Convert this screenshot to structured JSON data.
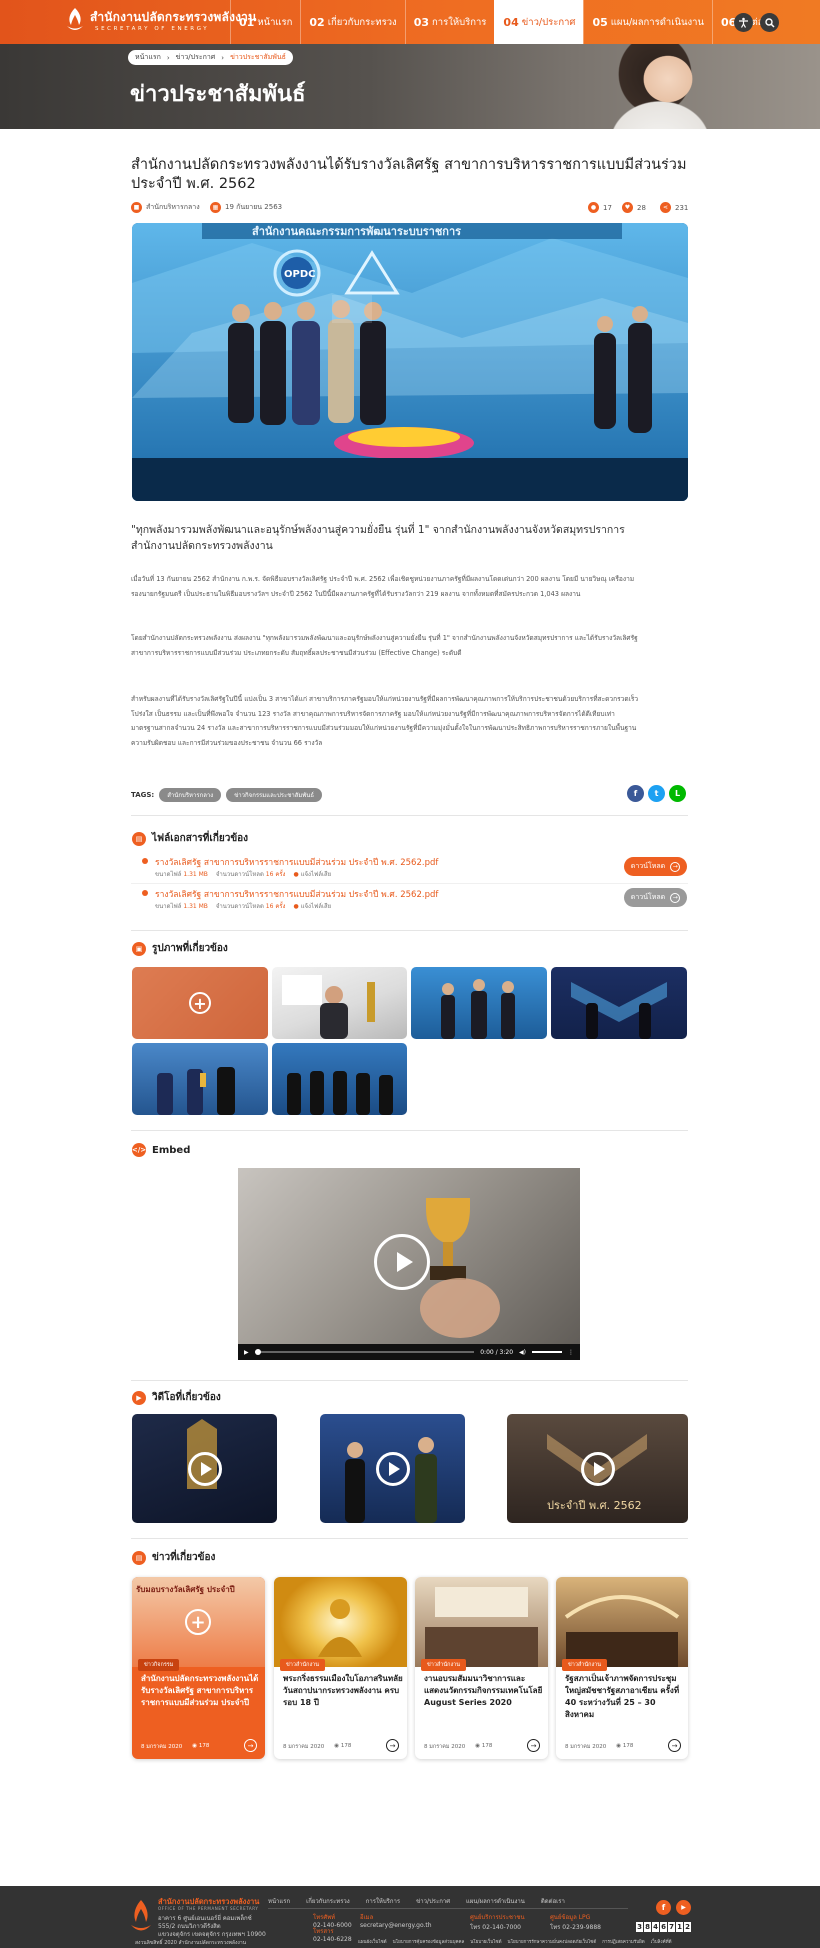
{
  "header": {
    "logo_th": "สำนักงานปลัดกระทรวงพลังงาน",
    "logo_en": "SECRETARY OF ENERGY",
    "nav": [
      {
        "num": "01",
        "label": "หน้าแรก"
      },
      {
        "num": "02",
        "label": "เกี่ยวกับกระทรวง"
      },
      {
        "num": "03",
        "label": "การให้บริการ"
      },
      {
        "num": "04",
        "label": "ข่าว/ประกาศ"
      },
      {
        "num": "05",
        "label": "แผน/ผลการดำเนินงาน"
      },
      {
        "num": "06",
        "label": "ติดต่อเรา"
      }
    ],
    "accessibility_icon": "accessibility-icon",
    "search_icon": "search-icon"
  },
  "banner": {
    "breadcrumb": [
      "หน้าแรก",
      "ข่าว/ประกาศ",
      "ข่าวประชาสัมพันธ์"
    ],
    "title": "ข่าวประชาสัมพันธ์"
  },
  "article": {
    "title": "สำนักงานปลัดกระทรวงพลังงานได้รับรางวัลเลิศรัฐ สาขาการบริหารราชการแบบมีส่วนร่วม ประจำปี พ.ศ. 2562",
    "author": "สำนักบริหารกลาง",
    "date": "19 กันยายน 2563",
    "views": "17",
    "likes": "28",
    "shares": "231",
    "hero_banner_text": "สำนักงานคณะกรรมการพัฒนาระบบราชการ",
    "hero_logo": "OPDC",
    "lead": "\"ทุกพลังมารวมพลังพัฒนาและอนุรักษ์พลังงานสู่ความยั่งยืน รุ่นที่ 1\" จากสำนักงานพลังงานจังหวัดสมุทรปราการ สำนักงานปลัดกระทรวงพลังงาน",
    "paragraphs": [
      "เมื่อวันที่ 13 กันยายน 2562 สำนักงาน ก.พ.ร. จัดพิธีมอบรางวัลเลิศรัฐ ประจำปี พ.ศ. 2562 เพื่อเชิดชูหน่วยงานภาครัฐที่มีผลงานโดดเด่นกว่า 200 ผลงาน โดยมี นายวิษณุ เครืองาม รองนายกรัฐมนตรี เป็นประธานในพิธีมอบรางวัลฯ ประจำปี 2562 ในปีนี้มีผลงานภาครัฐที่ได้รับรางวัลกว่า 219 ผลงาน จากทั้งหมดที่สมัครประกวด 1,043 ผลงาน",
      "โดยสำนักงานปลัดกระทรวงพลังงาน ส่งผลงาน \"ทุกพลังมารวมพลังพัฒนาและอนุรักษ์พลังงานสู่ความยั่งยืน รุ่นที่ 1\" จากสำนักงานพลังงานจังหวัดสมุทรปราการ และได้รับรางวัลเลิศรัฐ สาขาการบริหารราชการแบบมีส่วนร่วม ประเภทยกระดับ สัมฤทธิ์ผลประชาชนมีส่วนร่วม (Effective Change) ระดับดี",
      "สำหรับผลงานที่ได้รับรางวัลเลิศรัฐในปีนี้ แบ่งเป็น 3 สาขาได้แก่ สาขาบริการภาครัฐมอบให้แก่หน่วยงานรัฐที่มีผลการพัฒนาคุณภาพการให้บริการประชาชนด้วยบริการที่สะดวกรวดเร็ว โปร่งใส เป็นธรรม และเป็นที่พึงพอใจ จำนวน 123 รางวัล สาขาคุณภาพการบริหารจัดการภาครัฐ มอบให้แก่หน่วยงานรัฐที่มีการพัฒนาคุณภาพการบริหารจัดการได้ดีเทียบเท่ามาตรฐานสากลจำนวน 24 รางวัล และสาขาการบริหารราชการแบบมีส่วนร่วมมอบให้แก่หน่วยงานรัฐที่มีความมุ่งมั่นตั้งใจในการพัฒนาประสิทธิภาพการบริหารราชการภายในพื้นฐานความรับผิดชอบ และการมีส่วนร่วมของประชาชน จำนวน 66 รางวัล"
    ],
    "tags_label": "TAGS:",
    "tags": [
      "สำนักบริหารกลาง",
      "ข่าวกิจกรรมและประชาสัมพันธ์"
    ],
    "share": [
      {
        "icon": "facebook-icon",
        "glyph": "f",
        "color": "#3b5998"
      },
      {
        "icon": "twitter-icon",
        "glyph": "t",
        "color": "#1da1f2"
      },
      {
        "icon": "line-icon",
        "glyph": "L",
        "color": "#00b900"
      }
    ]
  },
  "files": {
    "heading": "ไฟล์เอกสารที่เกี่ยวข้อง",
    "items": [
      {
        "name": "รางวัลเลิศรัฐ สาขาการบริหารราชการแบบมีส่วนร่วม ประจำปี พ.ศ. 2562.pdf",
        "size_label": "ขนาดไฟล์",
        "size": "1.31 MB",
        "dl_label": "จำนวนดาวน์โหลด",
        "downloads": "16 ครั้ง",
        "report": "แจ้งไฟล์เสีย",
        "button": "ดาวน์โหลด",
        "button_color": "#ee5f21"
      },
      {
        "name": "รางวัลเลิศรัฐ สาขาการบริหารราชการแบบมีส่วนร่วม ประจำปี พ.ศ. 2562.pdf",
        "size_label": "ขนาดไฟล์",
        "size": "1.31 MB",
        "dl_label": "จำนวนดาวน์โหลด",
        "downloads": "16 ครั้ง",
        "report": "แจ้งไฟล์เสีย",
        "button": "ดาวน์โหลด",
        "button_color": "#9a9a9a"
      }
    ]
  },
  "gallery": {
    "heading": "รูปภาพที่เกี่ยวข้อง",
    "count": 6
  },
  "embed": {
    "heading": "Embed",
    "time": "0:00 / 3:20"
  },
  "videos": {
    "heading": "วิดีโอที่เกี่ยวข้อง",
    "overlay_text": "ประจำปี พ.ศ. 2562"
  },
  "news": {
    "heading": "ข่าวที่เกี่ยวข้อง",
    "items": [
      {
        "badge": "ข่าวกิจกรรม",
        "title": "สำนักงานปลัดกระทรวงพลังงานได้รับรางวัลเลิศรัฐ สาขาการบริหารราชการแบบมีส่วนร่วม ประจำปี",
        "date": "8 มกราคม 2020",
        "views": "178",
        "img_text": "รับมอบรางวัลเลิศรัฐ ประจำปี"
      },
      {
        "badge": "ข่าวสำนักงาน",
        "title": "พระกริ่งธรรมเมืองใบโอภาสรินทลัย วันสถาปนากระทรวงพลังงาน ครบรอบ 18 ปี",
        "date": "8 มกราคม 2020",
        "views": "178"
      },
      {
        "badge": "ข่าวสำนักงาน",
        "title": "งานอบรมสัมมนาวิชาการและแสดงนวัตกรรมกิจกรรมเทคโนโลยี August Series 2020",
        "date": "8 มกราคม 2020",
        "views": "178"
      },
      {
        "badge": "ข่าวสำนักงาน",
        "title": "รัฐสภาเป็นเจ้าภาพจัดการประชุมใหญ่สมัชชารัฐสภาอาเซียน ครั้งที่ 40 ระหว่างวันที่ 25 – 30 สิงหาคม",
        "date": "8 มกราคม 2020",
        "views": "178"
      }
    ]
  },
  "footer": {
    "org": "สำนักงานปลัดกระทรวงพลังงาน",
    "org_en": "OFFICE OF THE PERMANENT SECRETARY",
    "address": [
      "อาคาร 6 ศูนย์เอนเนอร์ยี่ คอมเพล็กซ์",
      "555/2 ถนนวิภาวดีรังสิต",
      "แขวงจตุจักร เขตจตุจักร กรุงเทพฯ 10900"
    ],
    "copyright": "สงวนลิขสิทธิ์ 2020 สำนักงานปลัดกระทรวงพลังงาน",
    "links": [
      "หน้าแรก",
      "เกี่ยวกับกระทรวง",
      "การให้บริการ",
      "ข่าว/ประกาศ",
      "แผน/ผลการดำเนินงาน",
      "ติดต่อเรา"
    ],
    "contacts": [
      {
        "label": "โทรศัพท์",
        "value": "02-140-6000"
      },
      {
        "label": "โทรสาร",
        "value": "02-140-6228"
      },
      {
        "label": "อีเมล",
        "value": "secretary@energy.go.th"
      },
      {
        "label": "ศูนย์บริการประชาชน",
        "value": "โทร 02-140-7000"
      },
      {
        "label": "ศูนย์ข้อมูล LPG",
        "value": "โทร 02-239-9888"
      }
    ],
    "bottom_links": [
      "แผนผังเว็บไซต์",
      "นโยบายการคุ้มครองข้อมูลส่วนบุคคล",
      "นโยบายเว็บไซต์",
      "นโยบายการรักษาความมั่นคงปลอดภัยเว็บไซต์",
      "การปฏิเสธความรับผิด",
      "เว็บลิงค์ที่ดี"
    ],
    "counter": "3846712",
    "social": [
      {
        "icon": "facebook-icon",
        "glyph": "f"
      },
      {
        "icon": "youtube-icon",
        "glyph": "▶"
      }
    ]
  }
}
